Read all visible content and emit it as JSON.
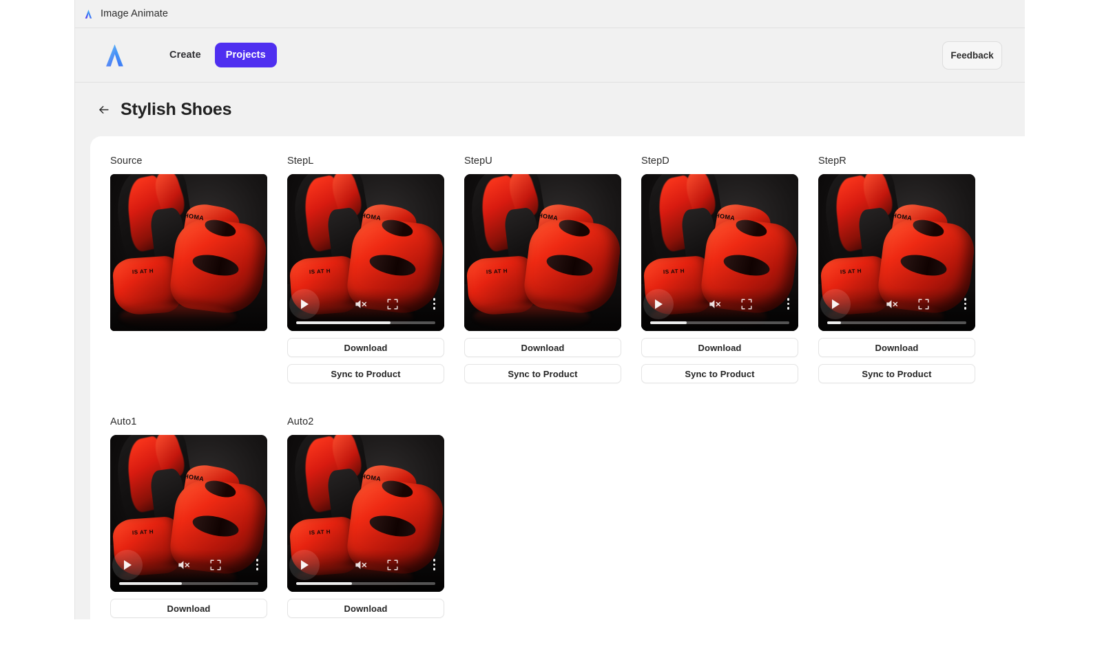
{
  "window": {
    "titlebar_title": "Image Animate",
    "titlebar_icon": "logo-a-icon"
  },
  "nav": {
    "logo_icon": "logo-a-icon",
    "links": [
      {
        "label": "Create",
        "active": false
      },
      {
        "label": "Projects",
        "active": true
      }
    ],
    "feedback_label": "Feedback",
    "accent_color": "#4f2ff0"
  },
  "page": {
    "back_icon": "arrow-left-icon",
    "title": "Stylish Shoes"
  },
  "buttons": {
    "download": "Download",
    "sync": "Sync to Product"
  },
  "video_controls": {
    "play_icon": "play-icon",
    "mute_icon": "volume-muted-icon",
    "fullscreen_icon": "fullscreen-icon",
    "more_icon": "more-vertical-icon"
  },
  "image_text": {
    "tag_top": "HOMA",
    "tag_bottom": "IS AT H"
  },
  "cards": [
    {
      "label": "Source",
      "type": "image",
      "has_controls": false,
      "progress_pct": 0,
      "actions": []
    },
    {
      "label": "StepL",
      "type": "video",
      "has_controls": true,
      "progress_pct": 68,
      "actions": [
        "Download",
        "Sync to Product"
      ]
    },
    {
      "label": "StepU",
      "type": "video",
      "has_controls": false,
      "progress_pct": 0,
      "actions": [
        "Download",
        "Sync to Product"
      ]
    },
    {
      "label": "StepD",
      "type": "video",
      "has_controls": true,
      "progress_pct": 26,
      "actions": [
        "Download",
        "Sync to Product"
      ]
    },
    {
      "label": "StepR",
      "type": "video",
      "has_controls": true,
      "progress_pct": 10,
      "actions": [
        "Download",
        "Sync to Product"
      ]
    },
    {
      "label": "Auto1",
      "type": "video",
      "has_controls": true,
      "progress_pct": 45,
      "actions": [
        "Download"
      ]
    },
    {
      "label": "Auto2",
      "type": "video",
      "has_controls": true,
      "progress_pct": 40,
      "actions": [
        "Download"
      ]
    }
  ]
}
